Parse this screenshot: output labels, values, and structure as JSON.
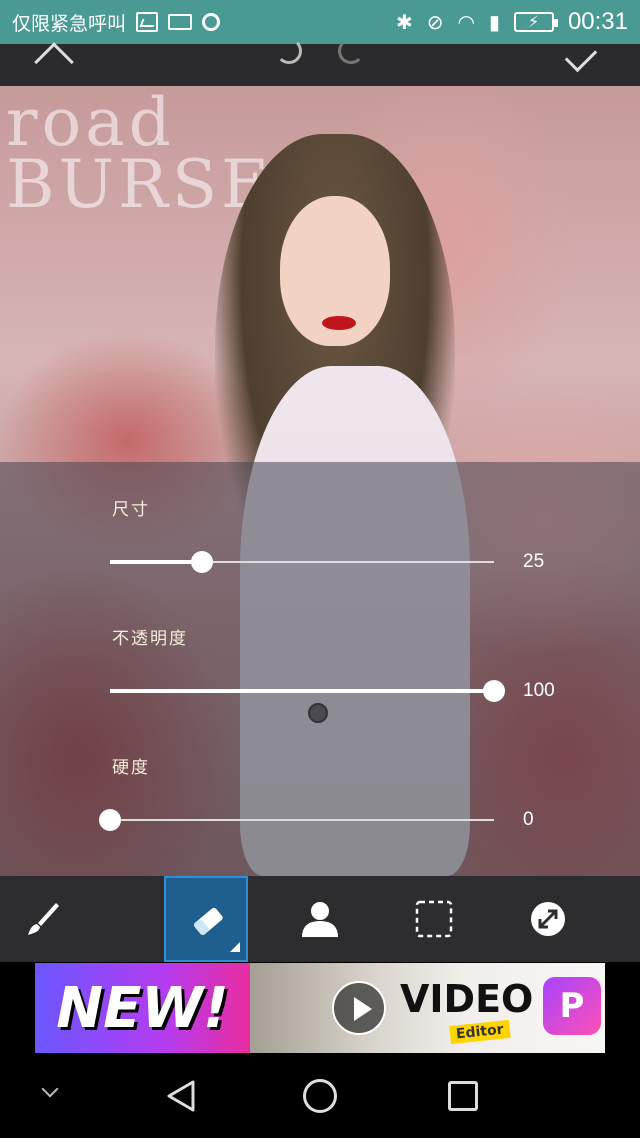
{
  "status_bar": {
    "carrier_text": "仅限紧急呼叫",
    "time": "00:31"
  },
  "top_toolbar": {
    "icons": [
      "chevron-up-icon",
      "undo-icon",
      "redo-icon",
      "check-icon"
    ]
  },
  "canvas": {
    "poster_text": "road\nBURSE"
  },
  "sliders": [
    {
      "label": "尺寸",
      "value": "25",
      "fraction": 0.24
    },
    {
      "label": "不透明度",
      "value": "100",
      "fraction": 1.0
    },
    {
      "label": "硬度",
      "value": "0",
      "fraction": 0.0
    }
  ],
  "tools": [
    {
      "name": "brush",
      "icon": "brush-icon",
      "active": false
    },
    {
      "name": "eraser",
      "icon": "eraser-icon",
      "active": true
    },
    {
      "name": "person",
      "icon": "person-icon",
      "active": false
    },
    {
      "name": "selection",
      "icon": "selection-icon",
      "active": false
    },
    {
      "name": "invert",
      "icon": "invert-icon",
      "active": false
    }
  ],
  "ad": {
    "headline": "NEW!",
    "product": "VIDEO",
    "tag": "Editor",
    "logo_letter": "P"
  },
  "colors": {
    "status_bar": "#4a9a94",
    "active_tool": "#1f5f8f"
  }
}
